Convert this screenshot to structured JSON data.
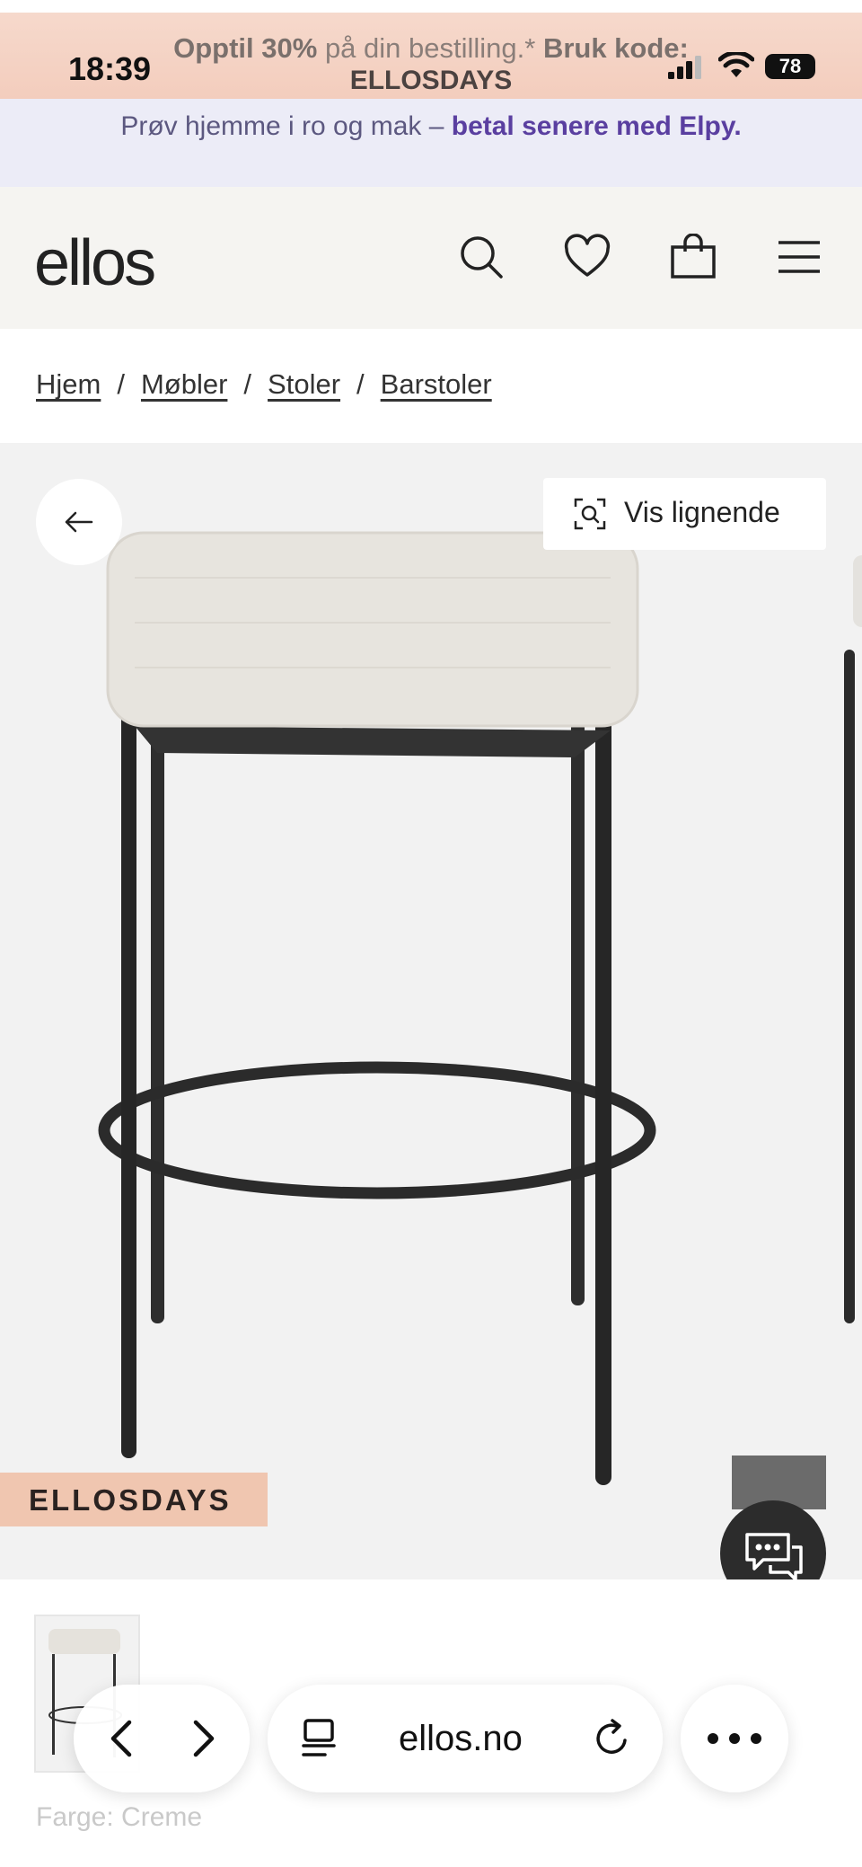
{
  "status_bar": {
    "time": "18:39",
    "battery": "78",
    "icons": [
      "signal-icon",
      "wifi-icon",
      "battery-icon"
    ]
  },
  "promo": {
    "highlight": "Opptil 30%",
    "middle": " på din bestilling.* ",
    "code_label": "Bruk kode:",
    "code": "ELLOSDAYS"
  },
  "elpy_banner": {
    "text": "Prøv hjemme i ro og mak – ",
    "link": "betal senere med Elpy."
  },
  "header": {
    "logo": "ellos",
    "icons": [
      "search-icon",
      "heart-icon",
      "bag-icon",
      "menu-icon"
    ]
  },
  "breadcrumb": [
    {
      "label": "Hjem"
    },
    {
      "label": "Møbler"
    },
    {
      "label": "Stoler"
    },
    {
      "label": "Barstoler"
    }
  ],
  "breadcrumb_separator": "/",
  "hero": {
    "similar_label": "Vis lignende",
    "campaign_badge": "ELLOSDAYS"
  },
  "product": {
    "color_label": "Farge: Creme"
  },
  "browser": {
    "url": "ellos.no"
  },
  "colors": {
    "promo_bg": "#f3cdbd",
    "elpy_bg": "#ececf7",
    "elpy_link": "#5a3fa0",
    "header_bg": "#f5f4f1",
    "badge_bg": "#f0c6b0"
  }
}
